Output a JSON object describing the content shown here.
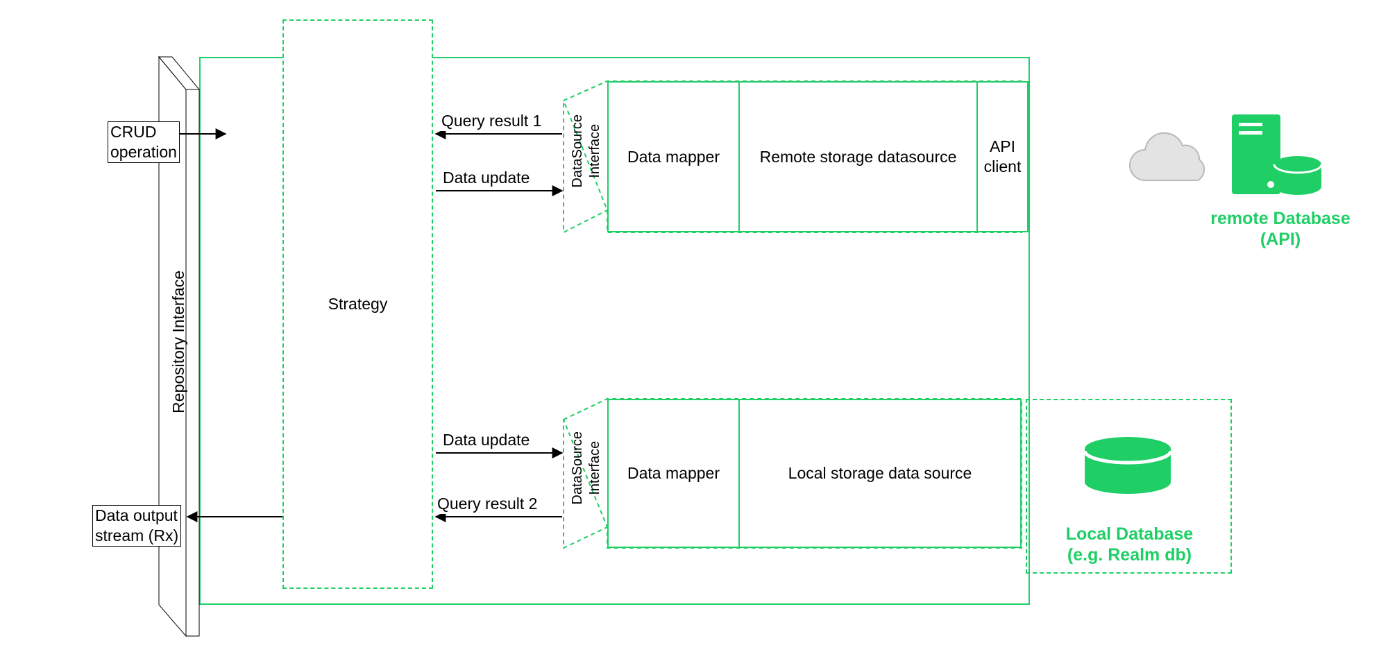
{
  "repoInterface": "Repository Interface",
  "strategy": "Strategy",
  "crudOp": "CRUD\noperation",
  "dataOutput": "Data output\nstream (Rx)",
  "arrows": {
    "queryResult1": "Query result 1",
    "dataUpdate1": "Data update",
    "dataUpdate2": "Data update",
    "queryResult2": "Query result 2"
  },
  "remote": {
    "dsInterface": "DataSource\nInterface",
    "dataMapper": "Data mapper",
    "datasource": "Remote storage datasource",
    "apiClient": "API\nclient",
    "dbLabel": "remote Database\n(API)"
  },
  "local": {
    "dsInterface": "DataSource\nInterface",
    "dataMapper": "Data mapper",
    "datasource": "Local storage data source",
    "dbLabel": "Local Database\n(e.g. Realm db)"
  }
}
